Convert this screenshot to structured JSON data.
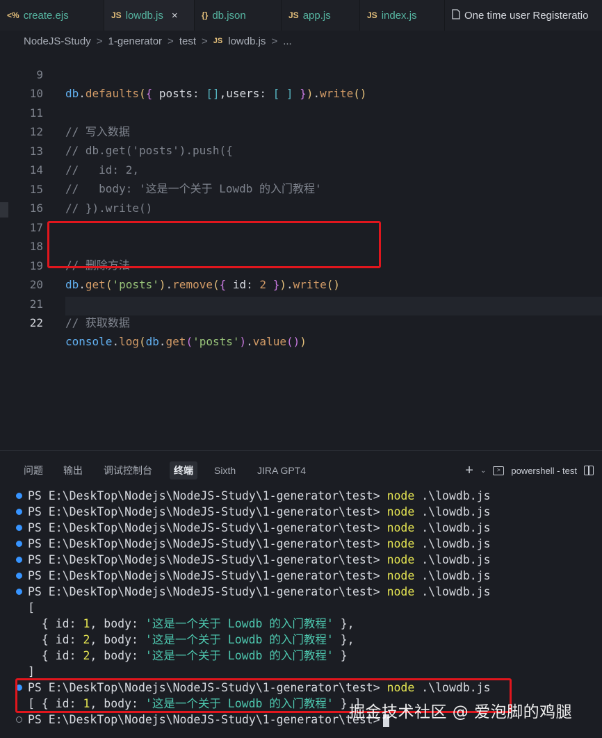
{
  "tabs": [
    {
      "icon": "<%",
      "label": "create.ejs"
    },
    {
      "icon": "JS",
      "label": "lowdb.js",
      "close": "×"
    },
    {
      "icon": "{}",
      "label": "db.json"
    },
    {
      "icon": "JS",
      "label": "app.js"
    },
    {
      "icon": "JS",
      "label": "index.js"
    },
    {
      "icon": "",
      "label": "One time user Registeratio"
    }
  ],
  "breadcrumb": {
    "items": [
      "NodeJS-Study",
      "1-generator",
      "test"
    ],
    "file_icon": "JS",
    "file": "lowdb.js",
    "more": "...",
    "sep": ">"
  },
  "editor": {
    "line_numbers": [
      "9",
      "10",
      "11",
      "12",
      "13",
      "14",
      "15",
      "16",
      "17",
      "18",
      "19",
      "20",
      "21",
      "22"
    ],
    "current_line": "22",
    "lines": {
      "l9": {
        "a": "db",
        "b": ".",
        "c": "defaults",
        "d": "(",
        "e": "{",
        "f": " posts",
        "g": ": ",
        "h": "[]",
        "i": ",users",
        "j": ": ",
        "k": "[ ]",
        "l": " }",
        "m": ")",
        "n": ".",
        "o": "write",
        "p": "()"
      },
      "l11": "// 写入数据",
      "l12": "// db.get('posts').push({",
      "l13": "//   id: 2,",
      "l14": "//   body: '这是一个关于 Lowdb 的入门教程'",
      "l15": "// }).write()",
      "l18": "// 删除方法",
      "l19": {
        "a": "db",
        "b": ".",
        "c": "get",
        "d": "(",
        "e": "'posts'",
        "f": ")",
        "g": ".",
        "h": "remove",
        "i": "(",
        "j": "{",
        "k": " id",
        "l": ": ",
        "m": "2",
        "n": " }",
        "o": ")",
        "p": ".",
        "q": "write",
        "r": "()"
      },
      "l21": "// 获取数据",
      "l22": {
        "a": "console",
        "b": ".",
        "c": "log",
        "d": "(",
        "e": "db",
        "f": ".",
        "g": "get",
        "h": "(",
        "i": "'posts'",
        "j": ")",
        "k": ".",
        "l": "value",
        "m": "()",
        "n": ")"
      }
    }
  },
  "panel": {
    "tabs": [
      "问题",
      "输出",
      "调试控制台",
      "终端",
      "Sixth",
      "JIRA GPT4"
    ],
    "active_tab": "终端",
    "plus": "+",
    "chevron": "⌄",
    "terminal_name": "powershell - test"
  },
  "terminal": {
    "prompt": "PS E:\\DeskTop\\Nodejs\\NodeJS-Study\\1-generator\\test> ",
    "cmd": "node",
    "arg": " .\\lowdb.js",
    "out_open": "[",
    "rows": [
      {
        "pre": "  { id: ",
        "num": "1",
        "mid": ", body: ",
        "str": "'这是一个关于 Lowdb 的入门教程'",
        "post": " },"
      },
      {
        "pre": "  { id: ",
        "num": "2",
        "mid": ", body: ",
        "str": "'这是一个关于 Lowdb 的入门教程'",
        "post": " },"
      },
      {
        "pre": "  { id: ",
        "num": "2",
        "mid": ", body: ",
        "str": "'这是一个关于 Lowdb 的入门教程'",
        "post": " }"
      }
    ],
    "out_close": "]",
    "final": {
      "pre": "[ { id: ",
      "num": "1",
      "mid": ", body: ",
      "str": "'这是一个关于 Lowdb 的入门教程'",
      "post": " } ]"
    },
    "last_prompt": "PS E:\\DeskTop\\Nodejs\\NodeJS-Study\\1-generator\\test>"
  },
  "watermark": "掘金技术社区 @ 爱泡脚的鸡腿",
  "colors": {
    "accent_red": "#e0161d",
    "terminal_dot": "#3794ff",
    "node_yellow": "#e5e552",
    "string_teal": "#4ec9b0"
  }
}
